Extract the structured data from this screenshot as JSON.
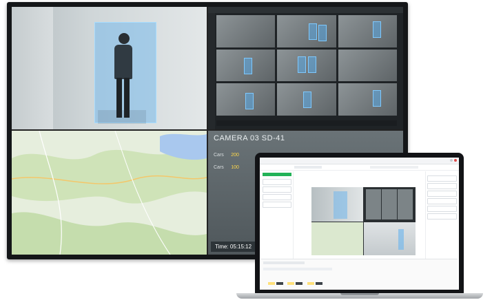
{
  "monitor": {
    "camera_title": "CAMERA 03 SD-41",
    "overlay_lines": [
      {
        "label": "Cars",
        "value": "200"
      },
      {
        "label": "Cars",
        "value": "100"
      }
    ],
    "time_label": "Time: 05:15:12"
  },
  "colors": {
    "accent_green": "#22b257",
    "detection_box": "#7ec9ff",
    "highlight_yellow": "#ffd84a"
  }
}
